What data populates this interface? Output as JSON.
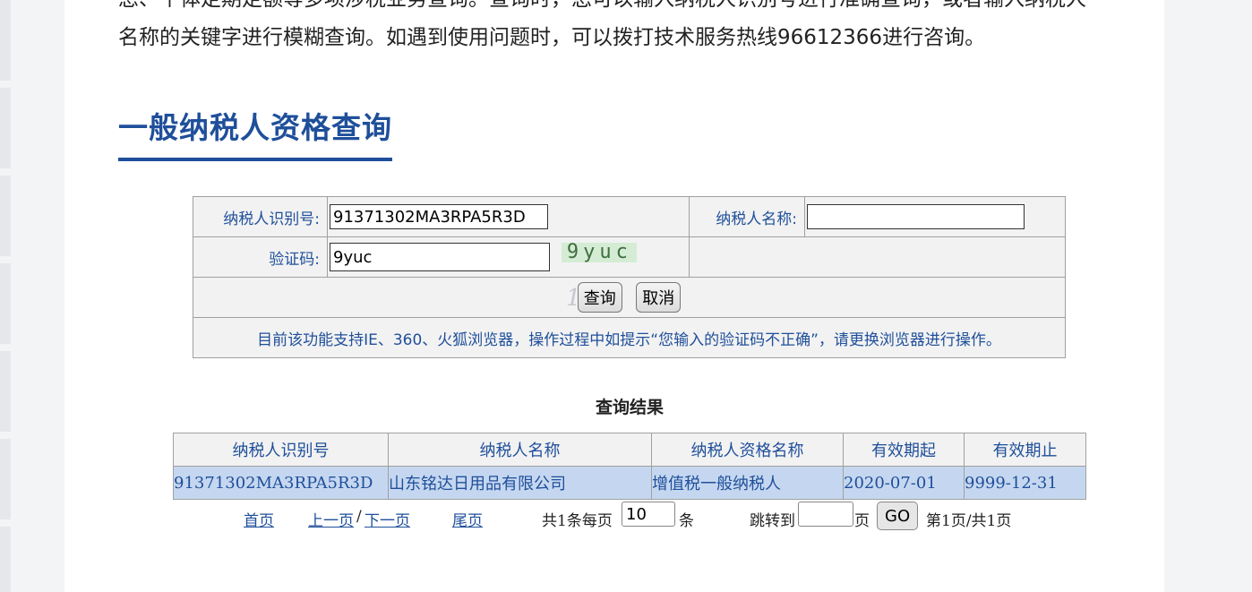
{
  "intro": {
    "line1": "息、个体定期定额等多项涉税业务查询。查询时，您可以输入纳税人识别号进行准确查询，或者输入纳税人",
    "line2": "名称的关键字进行模糊查询。如遇到使用问题时，可以拨打技术服务热线96612366进行咨询。"
  },
  "section_title": "一般纳税人资格查询",
  "form": {
    "taxpayer_id_label": "纳税人识别号:",
    "taxpayer_id_value": "91371302MA3RPA5R3D",
    "taxpayer_name_label": "纳税人名称:",
    "taxpayer_name_value": "",
    "captcha_label": "验证码:",
    "captcha_value": "9yuc",
    "captcha_image_text": "9yuc",
    "query_button": "查询",
    "cancel_button": "取消",
    "note": "目前该功能支持IE、360、火狐浏览器，操作过程中如提示“您输入的验证码不正确”，请更换浏览器进行操作。"
  },
  "results": {
    "title": "查询结果",
    "columns": [
      "纳税人识别号",
      "纳税人名称",
      "纳税人资格名称",
      "有效期起",
      "有效期止"
    ],
    "rows": [
      [
        "91371302MA3RPA5R3D",
        "山东铭达日用品有限公司",
        "增值税一般纳税人",
        "2020-07-01",
        "9999-12-31"
      ]
    ]
  },
  "pager": {
    "first": "首页",
    "prev": "上一页",
    "sep": "/",
    "next": "下一页",
    "last": "尾页",
    "summary_prefix": "共1条每页",
    "page_size": "10",
    "page_size_unit": "条",
    "jump_label": "跳转到",
    "jump_value": "",
    "page_unit": "页",
    "go_button": "GO",
    "status": "第1页/共1页"
  },
  "colors": {
    "accent": "#1f4f9a",
    "row_highlight": "#c5d7f0",
    "table_bg": "#f2f2f2"
  }
}
